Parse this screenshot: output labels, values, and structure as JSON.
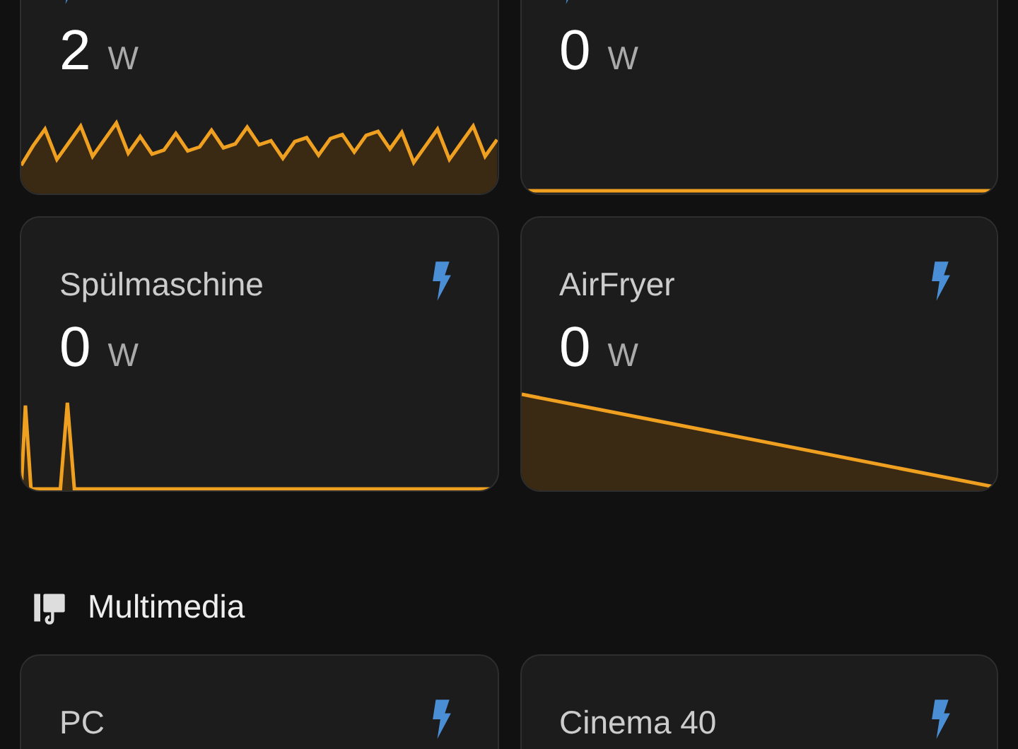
{
  "sections": [
    {
      "cards": [
        {
          "value": "2",
          "unit": "W",
          "kind": "wave"
        },
        {
          "value": "0",
          "unit": "W",
          "kind": "flat"
        },
        {
          "title": "Spülmaschine",
          "value": "0",
          "unit": "W",
          "kind": "spikes"
        },
        {
          "title": "AirFryer",
          "value": "0",
          "unit": "W",
          "kind": "slope"
        }
      ]
    },
    {
      "title": "Multimedia",
      "cards": [
        {
          "title": "PC"
        },
        {
          "title": "Cinema 40"
        }
      ]
    }
  ]
}
